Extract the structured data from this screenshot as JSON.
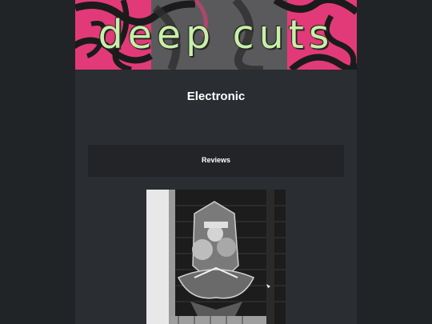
{
  "header": {
    "site_title": "deep cuts"
  },
  "page": {
    "category_title": "Electronic"
  },
  "section": {
    "label": "Reviews"
  },
  "colors": {
    "background": "#212427",
    "content": "#2a2d31",
    "banner_pink": "#e23a78",
    "title_green": "#c8f0a8",
    "section_box": "#222427"
  },
  "image": {
    "icon": "mural-photo"
  }
}
